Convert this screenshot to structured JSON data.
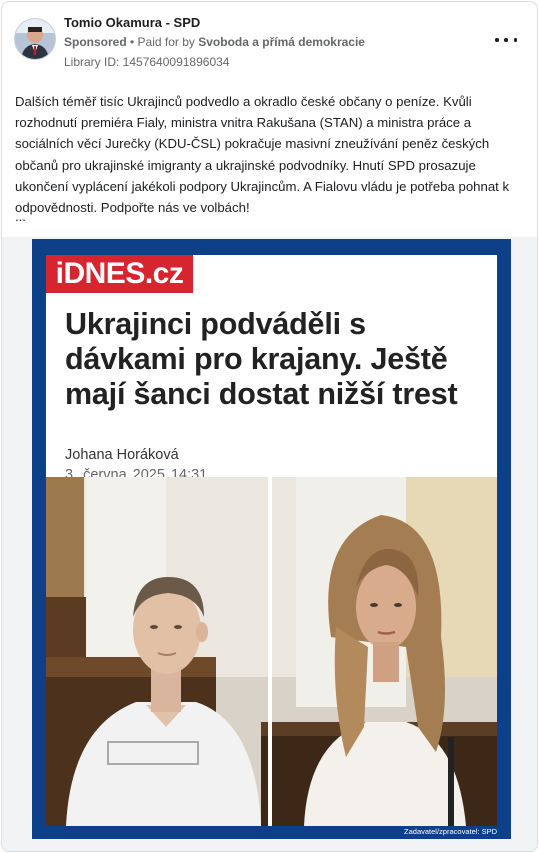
{
  "post": {
    "page_name": "Tomio Okamura - SPD",
    "sponsored": "Sponsored",
    "separator": " • ",
    "paid_for_prefix": "Paid for by ",
    "payer": "Svoboda a přímá demokracie",
    "library_id": "Library ID: 1457640091896034",
    "text": "Dalších téměř tisíc Ukrajinců podvedlo a okradlo české občany o peníze. Kvůli rozhodnutí premiéra Fialy, ministra vnitra Rakušana (STAN) a ministra práce a sociálních věcí Jurečky (KDU-ČSL) pokračuje masivní zneužívání peněz českých občanů pro ukrajinské imigranty a ukrajinské podvodníky. Hnutí SPD prosazuje ukončení vyplácení jakékoli podpory Ukrajincům. A Fialovu vládu je potřeba pohnat k odpovědnosti. Podpořte nás ve volbách!",
    "ellipsis": "...",
    "more_icon": "more-horizontal-icon"
  },
  "creative": {
    "logo_text": "iDNES.cz",
    "headline": "Ukrajinci podváděli s dávkami pro krajany. Ještě mají šanci dostat nižší trest",
    "author": "Johana Horáková",
    "date": "3. června 2025  14:31",
    "credit": "Zadavatel/zpracovatel: SPD"
  },
  "colors": {
    "frame_blue": "#0e3f89",
    "logo_red": "#d6252f",
    "meta_gray": "#65676b"
  }
}
